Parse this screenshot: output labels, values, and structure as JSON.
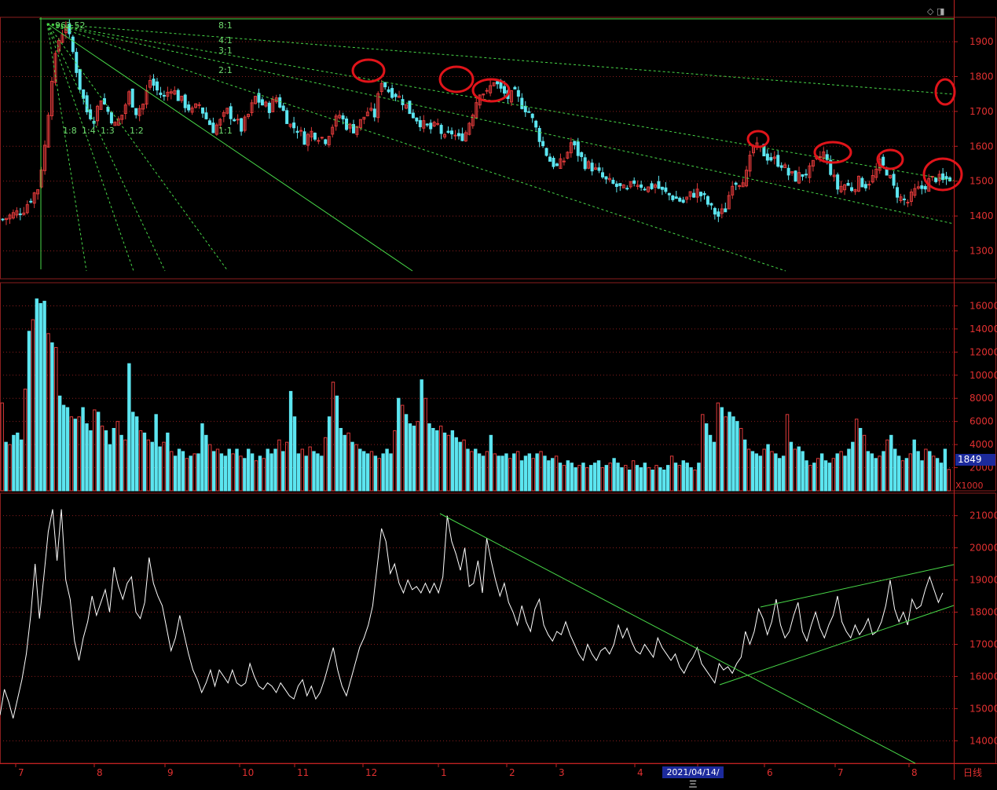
{
  "chart_data": [
    {
      "type": "candlestick",
      "name": "price",
      "peak_label": "962.52",
      "ylim": [
        1220,
        1970
      ],
      "yticks": [
        1300,
        1400,
        1500,
        1600,
        1700,
        1800,
        1900
      ],
      "colors": {
        "up": "#e03a3a",
        "down": "#5ce5f0",
        "line": "#48d848",
        "grid": "#8a1e1e",
        "annotation": "#e0141a"
      },
      "fan_labels": [
        "8:1",
        "4:1",
        "3:1",
        "2:1",
        "1:1",
        "1:2",
        "1:3",
        "1:4",
        "1:8"
      ],
      "highlighted_highs": [
        "2020-12",
        "2021-01",
        "2021-01-late",
        "2021-05",
        "2021-06",
        "2021-07",
        "2021-08-end"
      ],
      "close_path": [
        [
          0,
          1390
        ],
        [
          6,
          1420
        ],
        [
          10,
          1480
        ],
        [
          12,
          1600
        ],
        [
          14,
          1800
        ],
        [
          16,
          1905
        ],
        [
          18,
          1950
        ],
        [
          20,
          1870
        ],
        [
          22,
          1770
        ],
        [
          24,
          1700
        ],
        [
          26,
          1680
        ],
        [
          28,
          1740
        ],
        [
          30,
          1700
        ],
        [
          32,
          1660
        ],
        [
          34,
          1690
        ],
        [
          36,
          1750
        ],
        [
          38,
          1700
        ],
        [
          40,
          1720
        ],
        [
          42,
          1790
        ],
        [
          44,
          1760
        ],
        [
          46,
          1740
        ],
        [
          48,
          1770
        ],
        [
          50,
          1740
        ],
        [
          52,
          1720
        ],
        [
          54,
          1700
        ],
        [
          56,
          1720
        ],
        [
          58,
          1680
        ],
        [
          60,
          1650
        ],
        [
          62,
          1670
        ],
        [
          64,
          1700
        ],
        [
          66,
          1680
        ],
        [
          68,
          1650
        ],
        [
          70,
          1690
        ],
        [
          72,
          1740
        ],
        [
          74,
          1720
        ],
        [
          76,
          1710
        ],
        [
          78,
          1740
        ],
        [
          80,
          1700
        ],
        [
          82,
          1660
        ],
        [
          84,
          1650
        ],
        [
          86,
          1620
        ],
        [
          88,
          1640
        ],
        [
          90,
          1630
        ],
        [
          92,
          1620
        ],
        [
          94,
          1660
        ],
        [
          96,
          1690
        ],
        [
          98,
          1660
        ],
        [
          100,
          1650
        ],
        [
          102,
          1670
        ],
        [
          104,
          1700
        ],
        [
          106,
          1690
        ],
        [
          108,
          1790
        ],
        [
          110,
          1760
        ],
        [
          112,
          1750
        ],
        [
          114,
          1730
        ],
        [
          116,
          1700
        ],
        [
          118,
          1680
        ],
        [
          120,
          1660
        ],
        [
          122,
          1650
        ],
        [
          124,
          1660
        ],
        [
          126,
          1620
        ],
        [
          128,
          1640
        ],
        [
          130,
          1620
        ],
        [
          132,
          1640
        ],
        [
          134,
          1700
        ],
        [
          136,
          1760
        ],
        [
          138,
          1750
        ],
        [
          140,
          1790
        ],
        [
          142,
          1760
        ],
        [
          144,
          1740
        ],
        [
          146,
          1750
        ],
        [
          148,
          1720
        ],
        [
          150,
          1700
        ],
        [
          152,
          1650
        ],
        [
          154,
          1600
        ],
        [
          156,
          1560
        ],
        [
          158,
          1540
        ],
        [
          160,
          1560
        ],
        [
          162,
          1610
        ],
        [
          164,
          1580
        ],
        [
          166,
          1550
        ],
        [
          168,
          1540
        ],
        [
          170,
          1520
        ],
        [
          172,
          1500
        ],
        [
          174,
          1490
        ],
        [
          176,
          1480
        ],
        [
          178,
          1470
        ],
        [
          180,
          1500
        ],
        [
          182,
          1490
        ],
        [
          184,
          1480
        ],
        [
          186,
          1490
        ],
        [
          188,
          1470
        ],
        [
          190,
          1460
        ],
        [
          192,
          1450
        ],
        [
          194,
          1440
        ],
        [
          196,
          1460
        ],
        [
          198,
          1470
        ],
        [
          200,
          1450
        ],
        [
          202,
          1420
        ],
        [
          204,
          1400
        ],
        [
          206,
          1420
        ],
        [
          208,
          1500
        ],
        [
          210,
          1500
        ],
        [
          212,
          1520
        ],
        [
          214,
          1600
        ],
        [
          216,
          1590
        ],
        [
          218,
          1570
        ],
        [
          220,
          1560
        ],
        [
          222,
          1550
        ],
        [
          224,
          1520
        ],
        [
          226,
          1510
        ],
        [
          228,
          1520
        ],
        [
          230,
          1530
        ],
        [
          232,
          1560
        ],
        [
          234,
          1580
        ],
        [
          236,
          1530
        ],
        [
          238,
          1480
        ],
        [
          240,
          1490
        ],
        [
          242,
          1480
        ],
        [
          244,
          1500
        ],
        [
          246,
          1490
        ],
        [
          248,
          1510
        ],
        [
          250,
          1550
        ],
        [
          252,
          1530
        ],
        [
          254,
          1480
        ],
        [
          256,
          1450
        ],
        [
          258,
          1440
        ],
        [
          260,
          1470
        ],
        [
          262,
          1480
        ],
        [
          264,
          1500
        ],
        [
          266,
          1510
        ],
        [
          268,
          1500
        ],
        [
          270,
          1510
        ]
      ]
    },
    {
      "type": "bar",
      "name": "volume",
      "last_value": "1849",
      "unit": "X1000",
      "ylim": [
        0,
        18000
      ],
      "yticks": [
        2000,
        4000,
        6000,
        8000,
        10000,
        12000,
        14000,
        16000
      ],
      "values": [
        7600,
        4200,
        4000,
        4800,
        5000,
        4400,
        8800,
        13800,
        14800,
        16600,
        16200,
        16400,
        13600,
        12800,
        12400,
        8200,
        7400,
        7200,
        6400,
        6200,
        6400,
        7200,
        5800,
        5200,
        7000,
        6800,
        5600,
        5200,
        4000,
        5400,
        6000,
        4800,
        4400,
        11000,
        6800,
        6400,
        5200,
        5000,
        4400,
        4200,
        6600,
        3800,
        4200,
        5000,
        3400,
        3000,
        3600,
        3400,
        2800,
        3000,
        3200,
        3200,
        5800,
        4800,
        4000,
        3400,
        3600,
        3200,
        3000,
        3600,
        3200,
        3600,
        3000,
        2800,
        3600,
        3200,
        2600,
        3000,
        2800,
        3600,
        3200,
        3600,
        4400,
        3400,
        4200,
        8600,
        6400,
        3200,
        3600,
        3000,
        3800,
        3400,
        3200,
        3000,
        4600,
        6400,
        9400,
        8200,
        5400,
        4800,
        5000,
        4200,
        4000,
        3600,
        3400,
        3200,
        3400,
        3000,
        2800,
        3200,
        3600,
        3200,
        5200,
        8000,
        7400,
        6600,
        5800,
        5600,
        6000,
        9600,
        8000,
        5800,
        5400,
        5200,
        5600,
        5000,
        4800,
        5200,
        4600,
        4200,
        4400,
        3600,
        3400,
        3600,
        3200,
        3000,
        3400,
        4800,
        3200,
        3000,
        3000,
        3200,
        2800,
        3200,
        3400,
        2600,
        3000,
        3200,
        2800,
        3200,
        3400,
        3000,
        2600,
        2800,
        3000,
        2400,
        2200,
        2600,
        2400,
        2000,
        2200,
        2400,
        2000,
        2200,
        2400,
        2600,
        2000,
        2200,
        2400,
        2800,
        2400,
        2000,
        2200,
        1800,
        2600,
        2200,
        2000,
        2400,
        2000,
        1800,
        2200,
        2000,
        1800,
        2200,
        3000,
        2400,
        2200,
        2600,
        2400,
        2000,
        1800,
        2400,
        6600,
        5800,
        4800,
        4200,
        7600,
        7200,
        6400,
        6800,
        6400,
        6000,
        5400,
        4400,
        3600,
        3400,
        3200,
        3000,
        3600,
        4000,
        3400,
        3200,
        2800,
        3000,
        6600,
        4200,
        3600,
        3800,
        3400,
        2600,
        2200,
        2400,
        2800,
        3200,
        2600,
        2400,
        2800,
        3200,
        3400,
        3000,
        3600,
        4200,
        6200,
        5400,
        4800,
        3400,
        3200,
        2800,
        3000,
        3400,
        4400,
        4800,
        3600,
        3000,
        2600,
        2800,
        3200,
        4400,
        3400,
        2600,
        3600,
        3400,
        3000,
        2800,
        2400,
        3600,
        1849
      ]
    },
    {
      "type": "line",
      "name": "indicator",
      "ylim": [
        13300,
        21700
      ],
      "yticks": [
        14000,
        15000,
        16000,
        17000,
        18000,
        19000,
        20000,
        21000
      ],
      "x_categories": [
        "7",
        "8",
        "9",
        "10",
        "11",
        "12",
        "1",
        "2",
        "3",
        "4",
        "5",
        "6",
        "7",
        "8"
      ],
      "cursor_date": "2021/04/14/三",
      "period": "日线",
      "values": [
        14800,
        15600,
        15200,
        14700,
        15300,
        15900,
        16700,
        17900,
        19500,
        17800,
        19100,
        20500,
        21200,
        19600,
        21200,
        19000,
        18400,
        17100,
        16500,
        17200,
        17700,
        18500,
        17900,
        18300,
        18700,
        18000,
        19400,
        18800,
        18400,
        18900,
        19100,
        18000,
        17800,
        18300,
        19700,
        18900,
        18500,
        18200,
        17500,
        16800,
        17200,
        17900,
        17300,
        16700,
        16200,
        15900,
        15500,
        15800,
        16200,
        15700,
        16200,
        16000,
        15800,
        16200,
        15800,
        15700,
        15800,
        16400,
        16000,
        15700,
        15600,
        15800,
        15700,
        15500,
        15800,
        15600,
        15400,
        15300,
        15700,
        15900,
        15400,
        15700,
        15300,
        15500,
        15900,
        16400,
        16900,
        16200,
        15700,
        15400,
        15900,
        16400,
        16900,
        17200,
        17600,
        18200,
        19400,
        20600,
        20200,
        19200,
        19500,
        18900,
        18600,
        19000,
        18700,
        18800,
        18600,
        18900,
        18600,
        18900,
        18600,
        19100,
        21000,
        20200,
        19800,
        19300,
        20000,
        18800,
        18900,
        19600,
        18600,
        20300,
        19600,
        19000,
        18500,
        18900,
        18300,
        18000,
        17600,
        18200,
        17700,
        17400,
        18100,
        18400,
        17600,
        17300,
        17100,
        17400,
        17300,
        17700,
        17300,
        17000,
        16700,
        16500,
        17000,
        16700,
        16500,
        16800,
        16900,
        16700,
        17000,
        17600,
        17200,
        17500,
        17100,
        16800,
        16700,
        17000,
        16800,
        16600,
        17200,
        16900,
        16700,
        16500,
        16700,
        16300,
        16100,
        16400,
        16600,
        16900,
        16400,
        16200,
        16000,
        15800,
        16400,
        16200,
        16300,
        16100,
        16400,
        16600,
        17400,
        17000,
        17400,
        18100,
        17800,
        17300,
        17700,
        18400,
        17600,
        17200,
        17400,
        17900,
        18300,
        17400,
        17100,
        17600,
        18000,
        17500,
        17200,
        17600,
        17900,
        18500,
        17700,
        17400,
        17200,
        17600,
        17300,
        17500,
        17800,
        17300,
        17400,
        17700,
        18200,
        19000,
        18100,
        17700,
        18000,
        17600,
        18400,
        18100,
        18200,
        18700,
        19100,
        18700,
        18300,
        18600
      ]
    }
  ]
}
